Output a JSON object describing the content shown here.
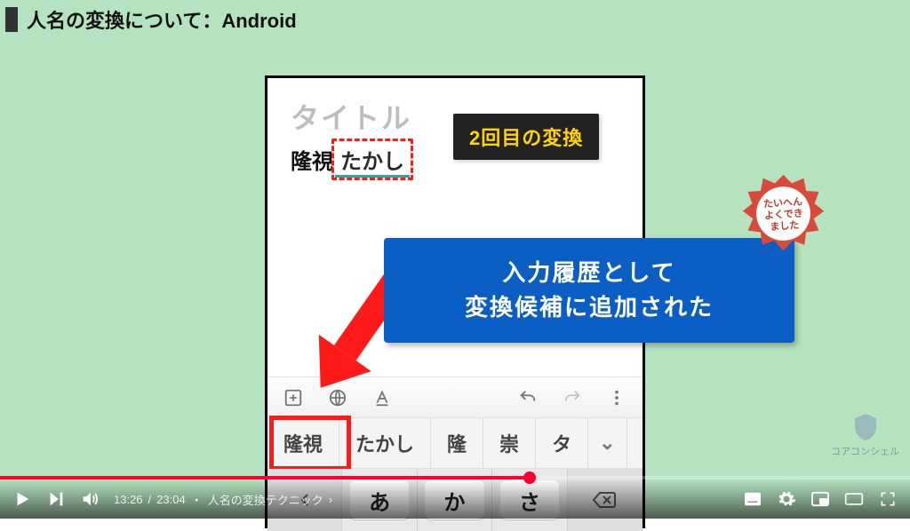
{
  "title": "人名の変換について：Android",
  "phone": {
    "placeholder": "タイトル",
    "fixed_text": "隆視",
    "marked_text": "たかし"
  },
  "notes": {
    "yellow": "2回目の変換",
    "blue_line1": "入力履歴として",
    "blue_line2": "変換候補に追加された"
  },
  "badge": {
    "line1": "たいへん",
    "line2": "よくでき",
    "line3": "ました"
  },
  "candidates": [
    "隆視",
    "たかし",
    "隆",
    "崇",
    "タ"
  ],
  "chevron": "⌄",
  "keys": {
    "left_fn": "←",
    "k1": "あ",
    "k2": "か",
    "k3": "さ",
    "bksp": "⌫"
  },
  "watermark": "コアコンシェル",
  "player": {
    "current": "13:26",
    "total": "23:04",
    "sep": "/",
    "chapter_prefix": "・",
    "chapter": "人名の変換テクニック",
    "chapter_chev": "›"
  }
}
